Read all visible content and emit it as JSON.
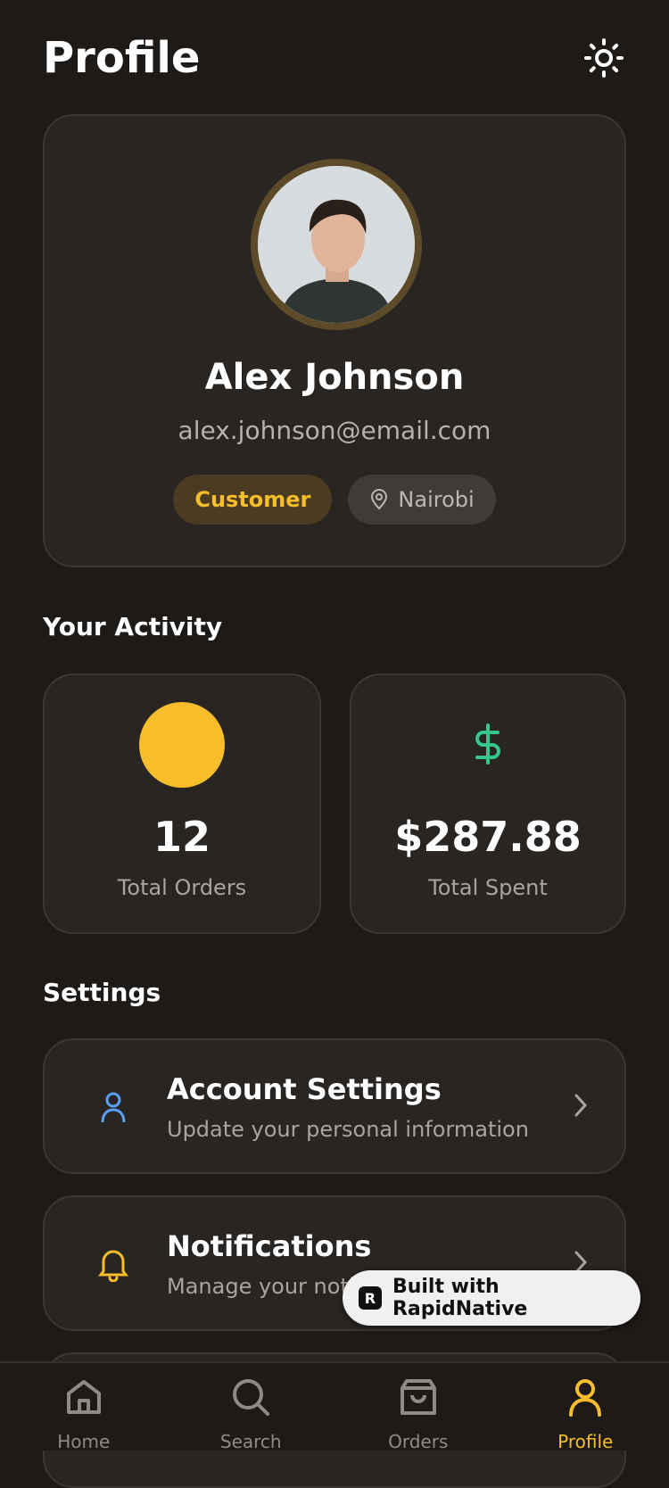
{
  "header": {
    "title": "Profile",
    "theme_icon": "sun-icon"
  },
  "profile": {
    "name": "Alex Johnson",
    "email": "alex.johnson@email.com",
    "role_badge": "Customer",
    "location": "Nairobi"
  },
  "activity": {
    "title": "Your Activity",
    "orders": {
      "value": "12",
      "label": "Total Orders"
    },
    "spent": {
      "value": "$287.88",
      "label": "Total Spent"
    }
  },
  "settings": {
    "title": "Settings",
    "items": [
      {
        "title": "Account Settings",
        "subtitle": "Update your personal information",
        "icon": "user-icon"
      },
      {
        "title": "Notifications",
        "subtitle": "Manage your notif",
        "icon": "bell-icon"
      }
    ]
  },
  "built_with": "Built with RapidNative",
  "nav": [
    {
      "label": "Home",
      "icon": "home-icon"
    },
    {
      "label": "Search",
      "icon": "search-icon"
    },
    {
      "label": "Orders",
      "icon": "shopping-bag-icon"
    },
    {
      "label": "Profile",
      "icon": "user-icon",
      "active": true
    }
  ],
  "colors": {
    "accent": "#f7bd2b",
    "money": "#34c68b",
    "user_icon": "#5aa2f1"
  }
}
